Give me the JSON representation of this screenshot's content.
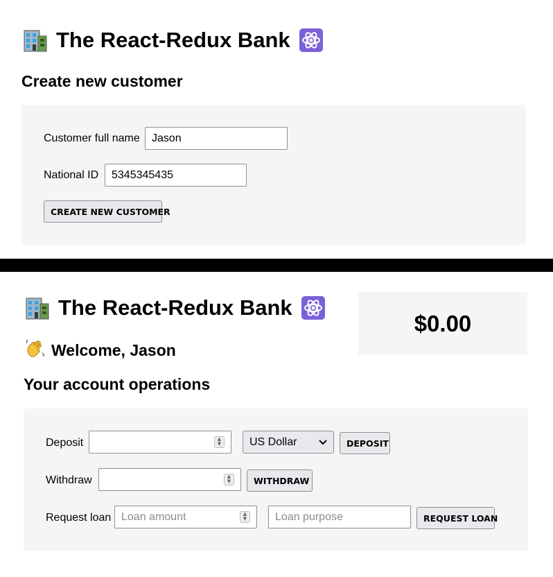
{
  "app": {
    "title": "The React-Redux Bank",
    "title_icon_left": "office-building-icon",
    "title_icon_right": "atom-icon"
  },
  "create_customer": {
    "heading": "Create new customer",
    "full_name_label": "Customer full name",
    "full_name_value": "Jason",
    "national_id_label": "National ID",
    "national_id_value": "5345345435",
    "submit_label": "CREATE NEW CUSTOMER"
  },
  "account": {
    "welcome_icon": "waving-hand-icon",
    "welcome_text": "Welcome, Jason",
    "balance": "$0.00",
    "operations_heading": "Your account operations",
    "deposit_label": "Deposit",
    "deposit_value": "",
    "currency_selected": "US Dollar",
    "deposit_button": "DEPOSIT",
    "withdraw_label": "Withdraw",
    "withdraw_value": "",
    "withdraw_button": "WITHDRAW",
    "loan_label": "Request loan",
    "loan_amount_placeholder": "Loan amount",
    "loan_purpose_placeholder": "Loan purpose",
    "loan_button": "REQUEST LOAN"
  },
  "colors": {
    "panel_background": "#f5f5f5",
    "button_background": "#e9e9ed",
    "divider": "#000000"
  }
}
